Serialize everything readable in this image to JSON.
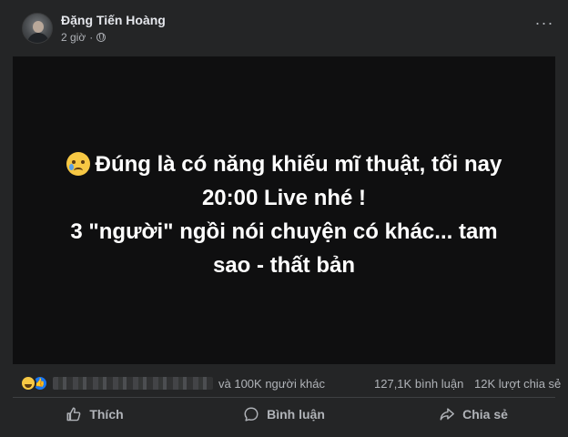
{
  "post": {
    "author": "Đặng Tiến Hoàng",
    "time": "2 giờ",
    "privacy_icon": "globe-icon",
    "more_label": "···",
    "text_lines": [
      "Đúng là có năng khiếu mĩ thuật, tối nay",
      "20:00 Live nhé !",
      "3 \"người\" ngồi nói chuyện có khác... tam",
      "sao - thất bản"
    ],
    "leading_emoji": "crying-face-emoji",
    "background_color": "#0f0f10"
  },
  "stats": {
    "reaction_icons": [
      "haha-reaction-icon",
      "like-reaction-icon"
    ],
    "others_text": "và 100K người khác",
    "comments_text": "127,1K bình luận",
    "shares_text": "12K lượt chia sẻ"
  },
  "actions": {
    "like_label": "Thích",
    "comment_label": "Bình luận",
    "share_label": "Chia sẻ"
  },
  "colors": {
    "card": "#242526",
    "text_primary": "#e4e6eb",
    "text_secondary": "#b0b3b8",
    "like_blue": "#1877f2"
  }
}
